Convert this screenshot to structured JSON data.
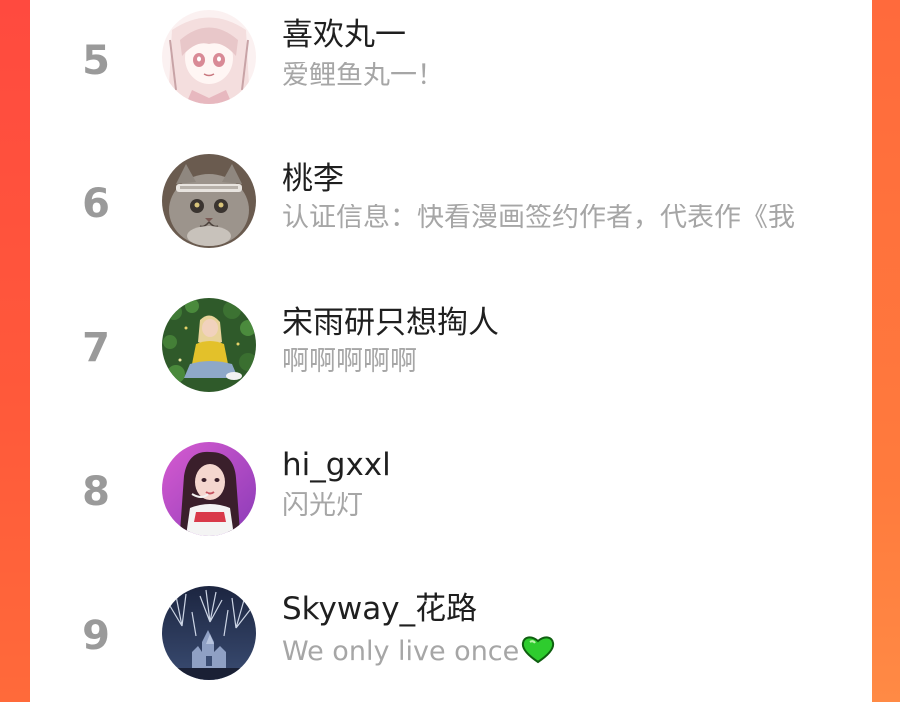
{
  "ranking": {
    "items": [
      {
        "rank": "5",
        "name": "喜欢丸一",
        "desc": "爱鲤鱼丸一！",
        "avatar": "anime-girl-avatar"
      },
      {
        "rank": "6",
        "name": "桃李",
        "desc": "认证信息：快看漫画签约作者，代表作《我",
        "avatar": "cat-avatar"
      },
      {
        "rank": "7",
        "name": "宋雨研只想掏人",
        "desc": "啊啊啊啊啊",
        "avatar": "girl-in-garden-avatar"
      },
      {
        "rank": "8",
        "name": "hi_gxxl",
        "desc": "闪光灯",
        "avatar": "performer-avatar"
      },
      {
        "rank": "9",
        "name": "Skyway_花路",
        "desc": "We only live once",
        "avatar": "fireworks-castle-avatar",
        "emoji": "green-heart-icon"
      }
    ]
  },
  "colors": {
    "background_left": "#ff4a3f",
    "background_right": "#ff7b3d",
    "rank_number": "#9a9a9a",
    "name_text": "#1f1f1f",
    "desc_text": "#a6a6a6",
    "heart": "#2ecc2e"
  }
}
